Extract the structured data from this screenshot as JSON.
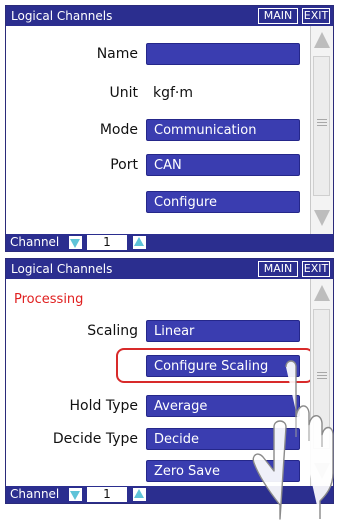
{
  "screen1": {
    "title": "Logical Channels",
    "main_label": "MAIN",
    "exit_label": "EXIT",
    "rows": {
      "name_label": "Name",
      "name_value": "",
      "unit_label": "Unit",
      "unit_value": "kgf·m",
      "mode_label": "Mode",
      "mode_value": "Communication",
      "port_label": "Port",
      "port_value": "CAN",
      "configure_label": "Configure"
    },
    "channel_label": "Channel",
    "channel_value": "1"
  },
  "screen2": {
    "title": "Logical Channels",
    "main_label": "MAIN",
    "exit_label": "EXIT",
    "section_title": "Processing",
    "rows": {
      "scaling_label": "Scaling",
      "scaling_value": "Linear",
      "configure_scaling_label": "Configure Scaling",
      "hold_type_label": "Hold Type",
      "hold_type_value": "Average",
      "decide_type_label": "Decide Type",
      "decide_type_value": "Decide",
      "zero_save_label": "Zero Save"
    },
    "channel_label": "Channel",
    "channel_value": "1"
  },
  "colors": {
    "title_bar": "#2b2e8f",
    "field": "#3a3db0",
    "section": "#e02020",
    "highlight": "#d82a2a",
    "spinner_arrow": "#5fc3d8"
  },
  "icons": [
    "scroll-up-arrow-icon",
    "scroll-down-arrow-icon",
    "channel-decrement-icon",
    "channel-increment-icon",
    "pointing-hand-icon"
  ]
}
